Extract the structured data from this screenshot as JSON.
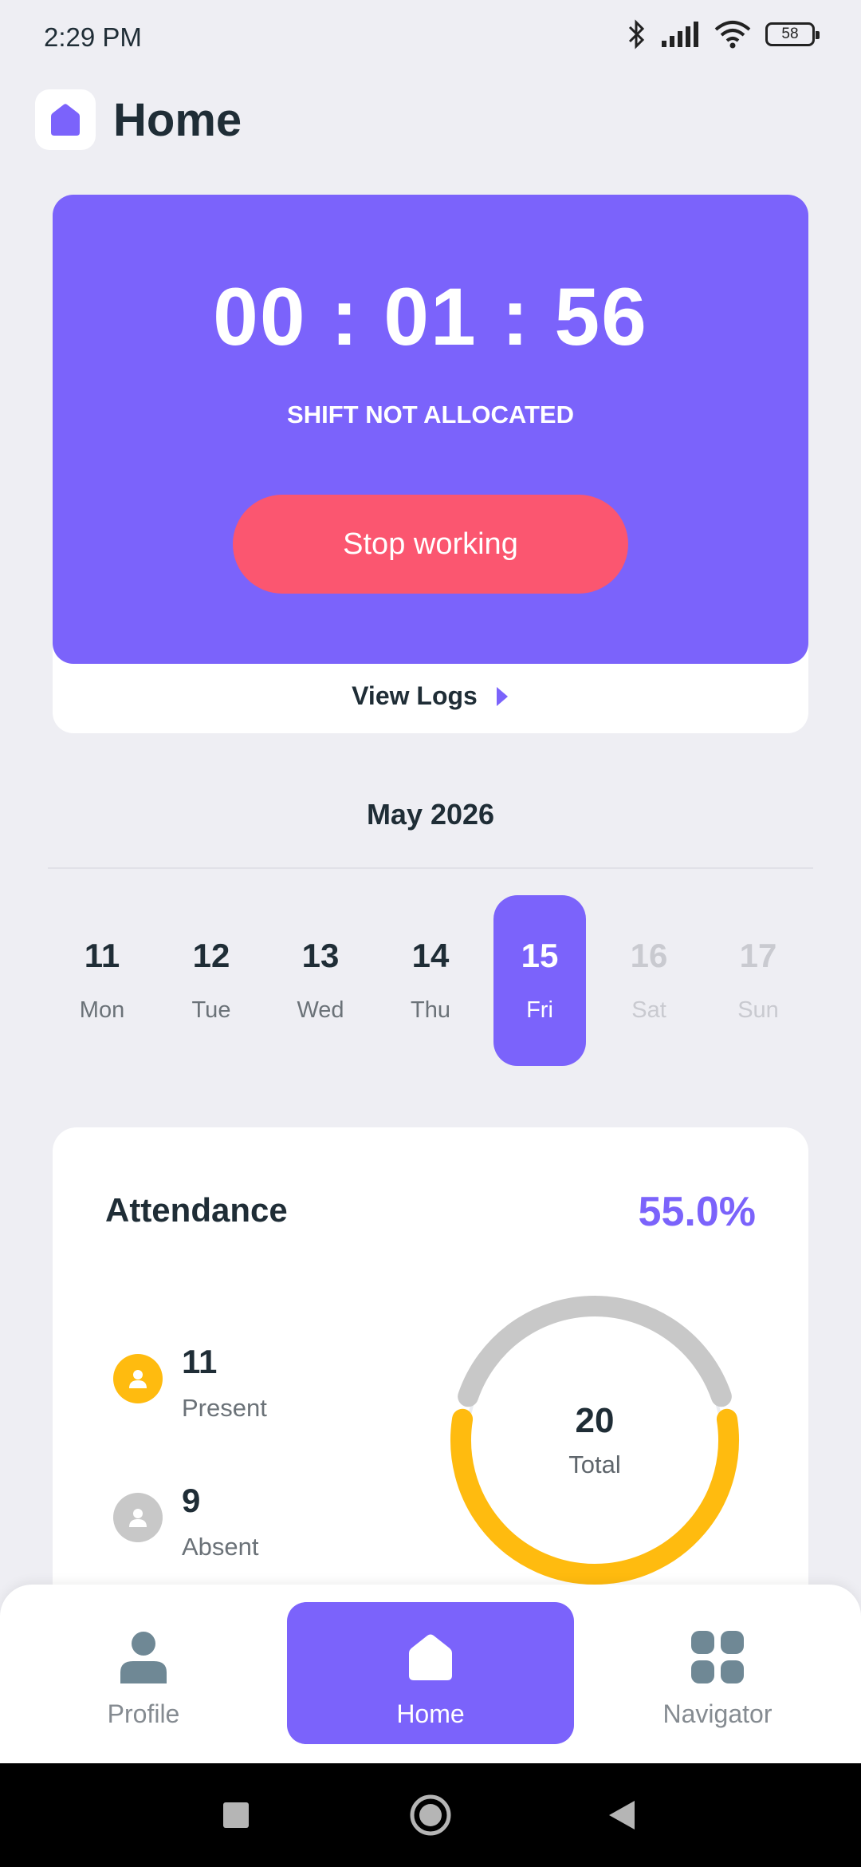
{
  "status_bar": {
    "time": "2:29 PM",
    "battery": "58"
  },
  "header": {
    "title": "Home",
    "logo_icon": "home-icon"
  },
  "timer_card": {
    "timer": "00 : 01 : 56",
    "shift_status": "SHIFT NOT ALLOCATED",
    "stop_button_label": "Stop working",
    "view_logs_label": "View Logs",
    "accent_color": "#7b63fb",
    "stop_color": "#fb5670"
  },
  "calendar": {
    "month": "May 2026",
    "days": [
      {
        "num": "11",
        "name": "Mon",
        "state": "normal"
      },
      {
        "num": "12",
        "name": "Tue",
        "state": "normal"
      },
      {
        "num": "13",
        "name": "Wed",
        "state": "normal"
      },
      {
        "num": "14",
        "name": "Thu",
        "state": "normal"
      },
      {
        "num": "15",
        "name": "Fri",
        "state": "selected"
      },
      {
        "num": "16",
        "name": "Sat",
        "state": "disabled"
      },
      {
        "num": "17",
        "name": "Sun",
        "state": "disabled"
      }
    ]
  },
  "attendance": {
    "title": "Attendance",
    "percent": "55.0%",
    "present": {
      "value": "11",
      "label": "Present",
      "color": "#ffbb0f"
    },
    "absent": {
      "value": "9",
      "label": "Absent",
      "color": "#c8c8c8"
    },
    "total": {
      "value": "20",
      "label": "Total"
    },
    "present_fraction": 0.55
  },
  "bottom_nav": {
    "items": [
      {
        "label": "Profile",
        "icon": "profile-icon",
        "active": false
      },
      {
        "label": "Home",
        "icon": "home-icon",
        "active": true
      },
      {
        "label": "Navigator",
        "icon": "grid-icon",
        "active": false
      }
    ]
  },
  "system_nav": {
    "icons": [
      "recents-icon",
      "home-circle-icon",
      "back-icon"
    ]
  }
}
